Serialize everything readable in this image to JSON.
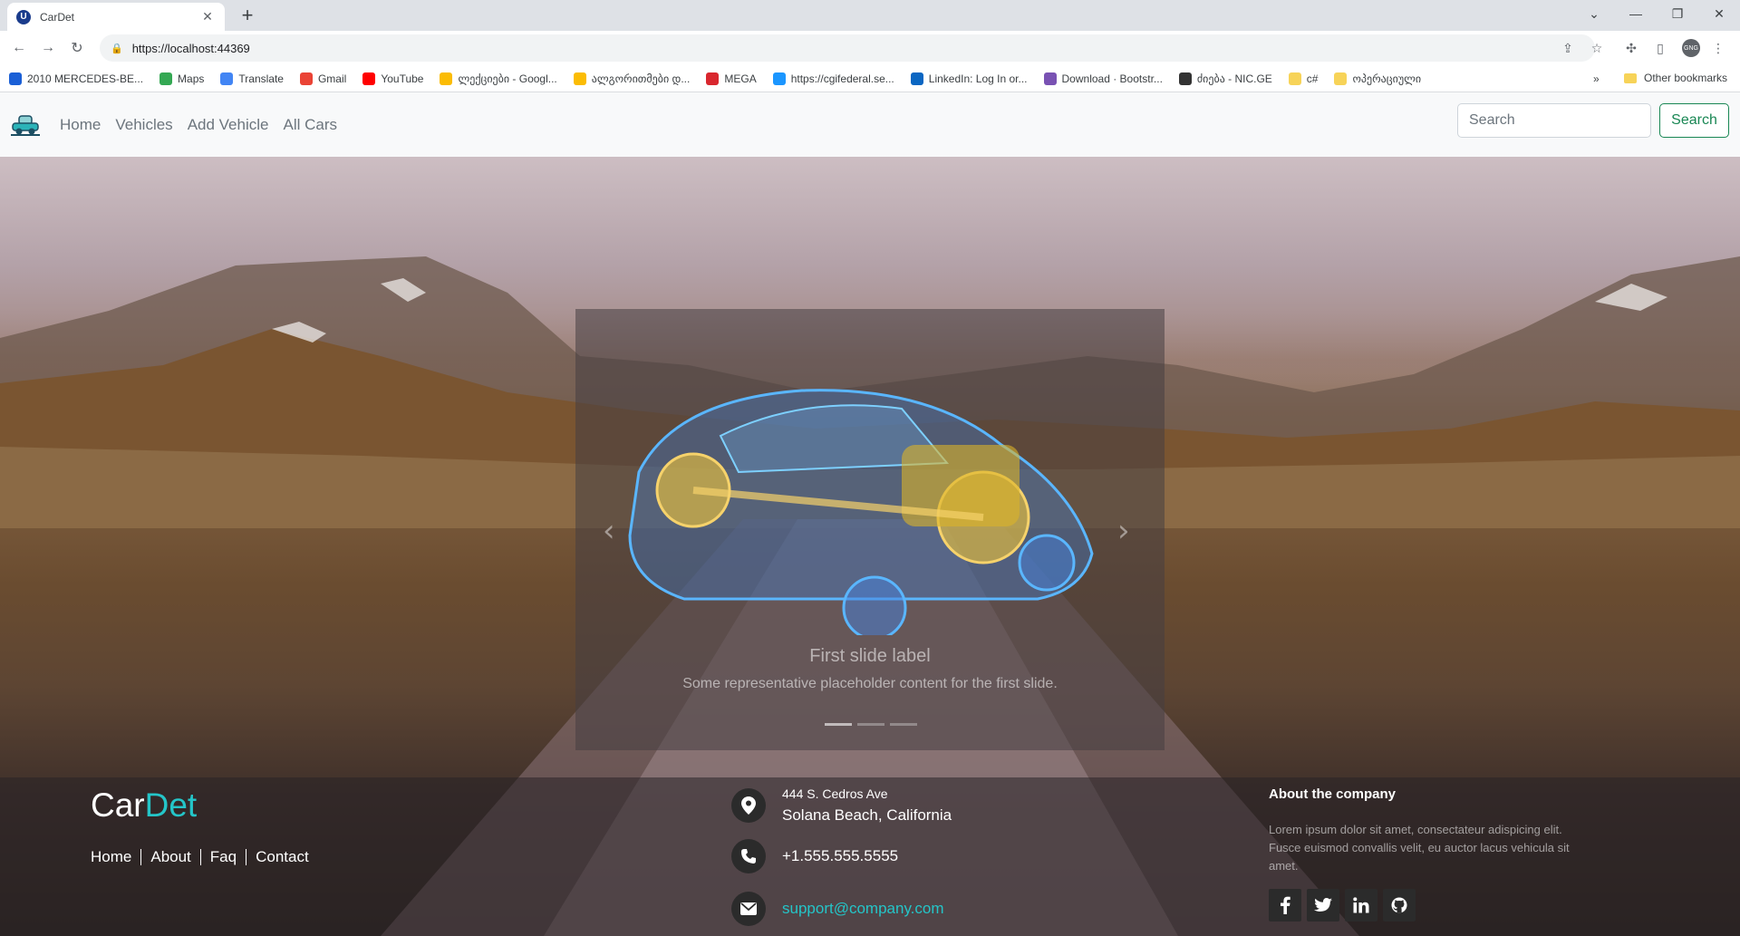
{
  "browser": {
    "tab_title": "CarDet",
    "favicon_letter": "U",
    "url": "https://localhost:44369",
    "profile_initials": "GNG",
    "bookmarks": [
      {
        "label": "2010 MERCEDES-BE...",
        "color": "#1a5fd6"
      },
      {
        "label": "Maps",
        "color": "#34a853"
      },
      {
        "label": "Translate",
        "color": "#4285f4"
      },
      {
        "label": "Gmail",
        "color": "#ea4335"
      },
      {
        "label": "YouTube",
        "color": "#ff0000"
      },
      {
        "label": "ლექციები - Googl...",
        "color": "#fbbc04"
      },
      {
        "label": "ალგორითმები დ...",
        "color": "#fbbc04"
      },
      {
        "label": "MEGA",
        "color": "#d9272e"
      },
      {
        "label": "https://cgifederal.se...",
        "color": "#1b96ff"
      },
      {
        "label": "LinkedIn: Log In or...",
        "color": "#0a66c2"
      },
      {
        "label": "Download · Bootstr...",
        "color": "#7952b3"
      },
      {
        "label": "ძიება - NIC.GE",
        "color": "#333333"
      },
      {
        "label": "c#",
        "color": "#f7d358"
      },
      {
        "label": "ოპერაციული",
        "color": "#f7d358"
      }
    ],
    "more_label": "»",
    "other_bookmarks": "Other bookmarks"
  },
  "navbar": {
    "links": [
      "Home",
      "Vehicles",
      "Add Vehicle",
      "All Cars"
    ],
    "search_placeholder": "Search",
    "search_button": "Search"
  },
  "carousel": {
    "title": "First slide label",
    "text": "Some representative placeholder content for the first slide.",
    "indicator_count": 3,
    "active_index": 0
  },
  "footer": {
    "logo_part1": "Car",
    "logo_part2": "Det",
    "links": [
      "Home",
      "About",
      "Faq",
      "Contact"
    ],
    "address_line1": "444 S. Cedros Ave",
    "address_line2": "Solana Beach, California",
    "phone": "+1.555.555.5555",
    "email": "support@company.com",
    "about_title": "About the company",
    "about_text": "Lorem ipsum dolor sit amet, consectateur adispicing elit. Fusce euismod convallis velit, eu auctor lacus vehicula sit amet.",
    "accent_color": "#24c5c8",
    "socials": [
      "facebook-icon",
      "twitter-icon",
      "linkedin-icon",
      "github-icon"
    ]
  }
}
